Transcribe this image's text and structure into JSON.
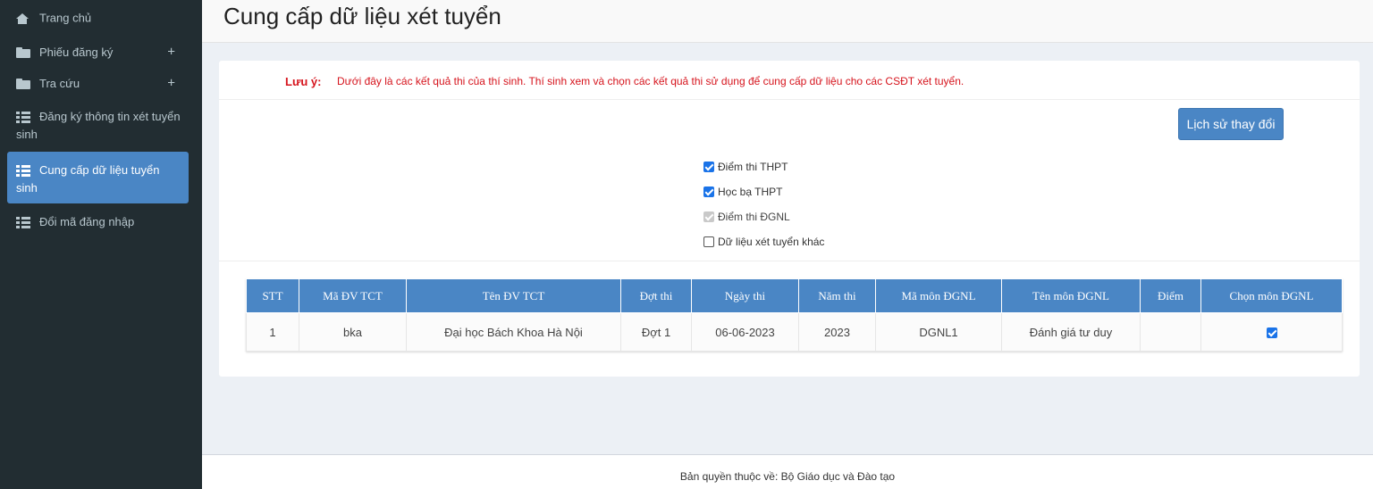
{
  "sidebar": {
    "items": [
      {
        "label": "Trang chủ",
        "icon": "home-icon"
      },
      {
        "label": "Phiếu đăng ký",
        "icon": "folder-icon",
        "expand": "+"
      },
      {
        "label": "Tra cứu",
        "icon": "folder-icon",
        "expand": "+"
      },
      {
        "label": "Đăng ký thông tin xét tuyển sinh",
        "icon": "list-icon"
      },
      {
        "label": "Cung cấp dữ liệu tuyển sinh",
        "icon": "list-icon",
        "active": true
      },
      {
        "label": "Đổi mã đăng nhập",
        "icon": "list-icon"
      }
    ]
  },
  "header": {
    "title": "Cung cấp dữ liệu xét tuyển"
  },
  "note": {
    "label": "Lưu ý:",
    "text": "Dưới đây là các kết quả thi của thí sinh. Thí sinh xem và chọn các kết quả thi sử dụng để cung cấp dữ liệu cho các CSĐT xét tuyển."
  },
  "history_button": "Lịch sử thay đổi",
  "options": [
    {
      "label": "Điểm thi THPT",
      "state": "checked"
    },
    {
      "label": "Học bạ THPT",
      "state": "checked"
    },
    {
      "label": "Điểm thi ĐGNL",
      "state": "checked-disabled"
    },
    {
      "label": "Dữ liệu xét tuyển khác",
      "state": "unchecked"
    }
  ],
  "table": {
    "headers": [
      "STT",
      "Mã ĐV TCT",
      "Tên ĐV TCT",
      "Đợt thi",
      "Ngày thi",
      "Năm thi",
      "Mã môn ĐGNL",
      "Tên môn ĐGNL",
      "Điểm",
      "Chọn môn ĐGNL"
    ],
    "rows": [
      {
        "stt": "1",
        "ma_dv": "bka",
        "ten_dv": "Đại học Bách Khoa Hà Nội",
        "dot_thi": "Đợt 1",
        "ngay_thi": "06-06-2023",
        "nam_thi": "2023",
        "ma_mon": "DGNL1",
        "ten_mon": "Đánh giá tư duy",
        "diem": "",
        "chon": true
      }
    ]
  },
  "footer": {
    "text": "Bản quyền thuộc về: Bộ Giáo dục và Đào tạo"
  },
  "colors": {
    "sidebar_bg": "#222d32",
    "accent": "#4a86c5",
    "note_red": "#d6141d",
    "checkbox_blue": "#1a73e8"
  }
}
